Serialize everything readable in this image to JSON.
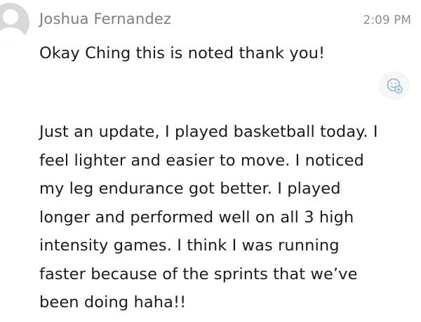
{
  "message": {
    "sender": "Joshua Fernandez",
    "time": "2:09 PM",
    "lines": [
      "Okay Ching this is noted thank you!",
      "Just an update, I played basketball today. I\nfeel lighter and easier to move. I noticed\nmy leg endurance got better. I played\nlonger and performed well on all 3 high\nintensity games. I think I was running\nfaster because of the sprints that we’ve\nbeen doing haha!!"
    ],
    "reaction_icon": "add-reaction-icon"
  },
  "colors": {
    "accent": "#8fb6cc",
    "avatar_bg": "#d6d8da",
    "meta_text": "#7d7d7d"
  }
}
